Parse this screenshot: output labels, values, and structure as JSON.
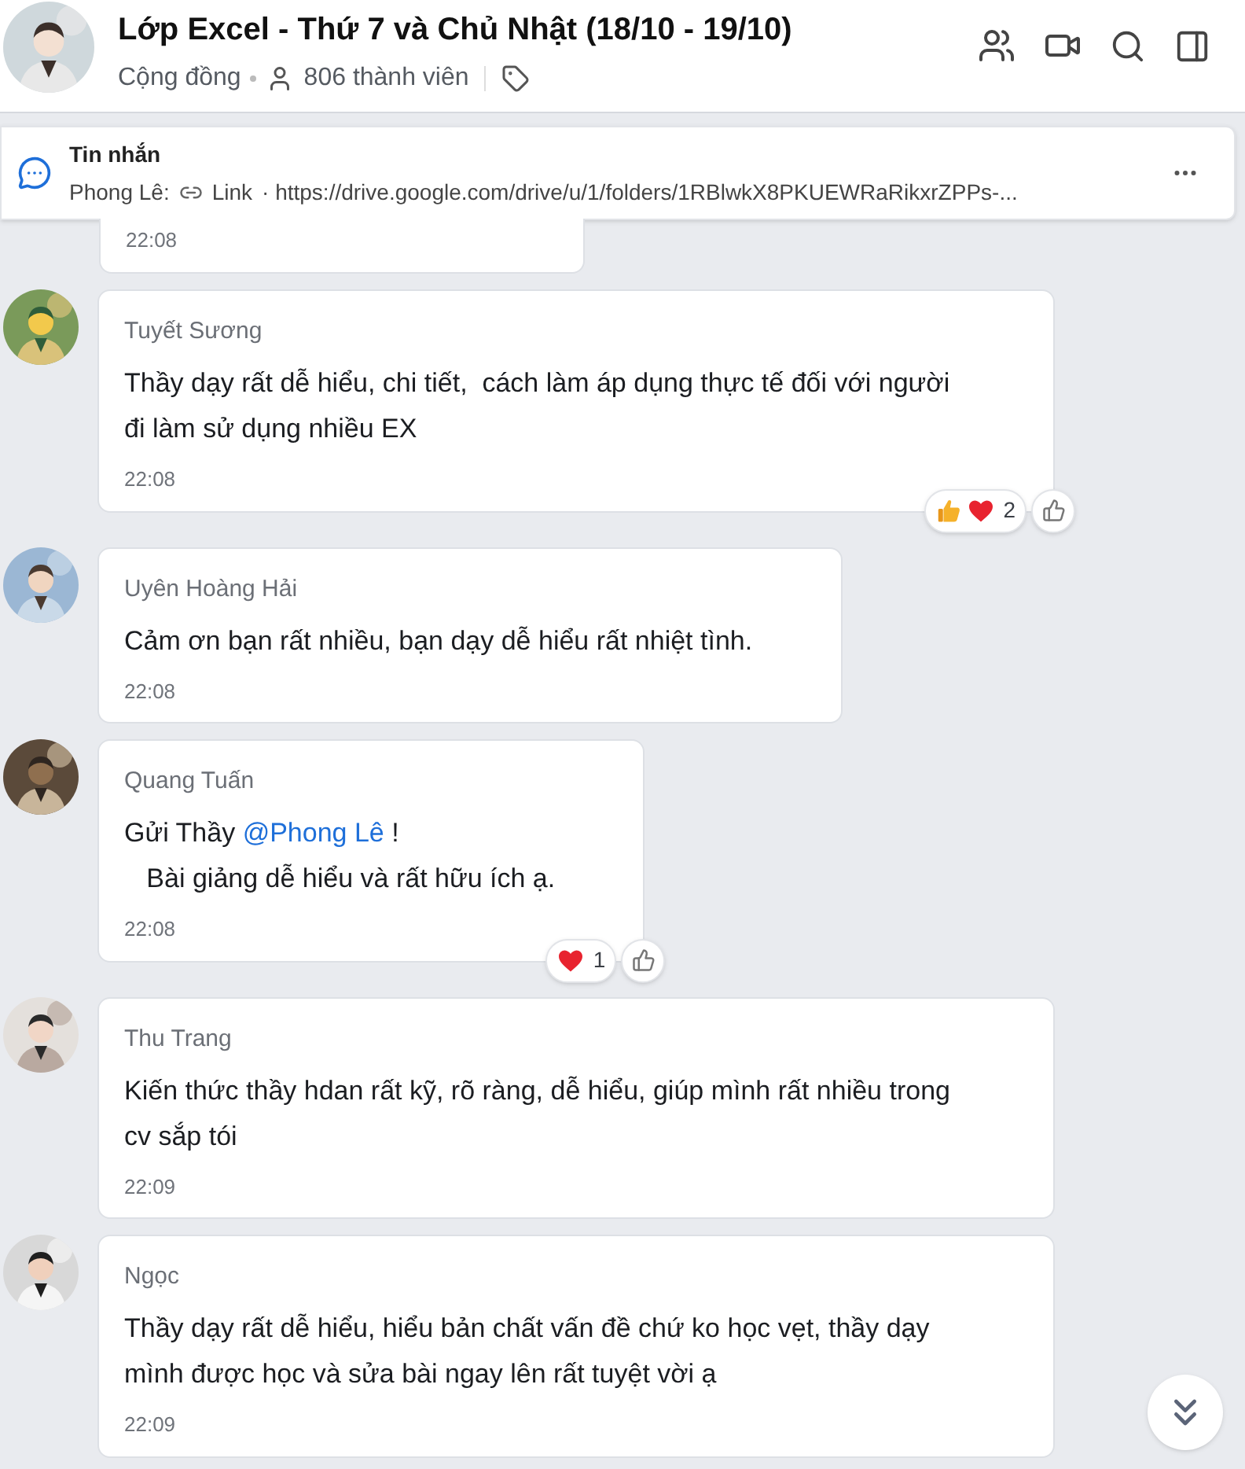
{
  "header": {
    "title": "Lớp Excel - Thứ 7 và Chủ Nhật (18/10 - 19/10)",
    "category": "Cộng đồng",
    "members": "806 thành viên"
  },
  "pinned": {
    "title": "Tin nhắn",
    "sender": "Phong Lê:",
    "link_label": "Link",
    "url": "· https://drive.google.com/drive/u/1/folders/1RBlwkX8PKUEWRaRikxrZPPs-..."
  },
  "partial_message": {
    "time": "22:08"
  },
  "messages": [
    {
      "sender": "Tuyết Sương",
      "segments": [
        {
          "kind": "text",
          "text": "Thầy dạy rất dễ hiểu, chi tiết,  cách làm áp dụng thực tế đối với người đi làm sử dụng nhiều EX"
        }
      ],
      "time": "22:08",
      "reactions": {
        "items": [
          {
            "kind": "like"
          },
          {
            "kind": "heart"
          }
        ],
        "count": "2"
      }
    },
    {
      "sender": "Uyên Hoàng Hải",
      "segments": [
        {
          "kind": "text",
          "text": "Cảm ơn bạn rất nhiều, bạn dạy dễ hiểu rất nhiệt tình."
        }
      ],
      "time": "22:08"
    },
    {
      "sender": "Quang Tuấn",
      "segments": [
        {
          "kind": "text",
          "text": "Gửi Thầy "
        },
        {
          "kind": "mention",
          "text": "@Phong Lê"
        },
        {
          "kind": "text",
          "text": " !\n   Bài giảng dễ hiểu và rất hữu ích ạ."
        }
      ],
      "time": "22:08",
      "reactions": {
        "items": [
          {
            "kind": "heart"
          }
        ],
        "count": "1"
      }
    },
    {
      "sender": "Thu Trang",
      "segments": [
        {
          "kind": "text",
          "text": "Kiến thức thầy hdan rất kỹ, rõ ràng, dễ hiểu, giúp mình rất nhiều trong cv sắp tói"
        }
      ],
      "time": "22:09"
    },
    {
      "sender": "Ngọc",
      "segments": [
        {
          "kind": "text",
          "text": "Thầy dạy rất dễ hiểu, hiểu bản chất vấn đề chứ ko học vẹt, thầy dạy mình được học và sửa bài ngay lên rất tuyệt vời ạ"
        }
      ],
      "time": "22:09"
    }
  ]
}
